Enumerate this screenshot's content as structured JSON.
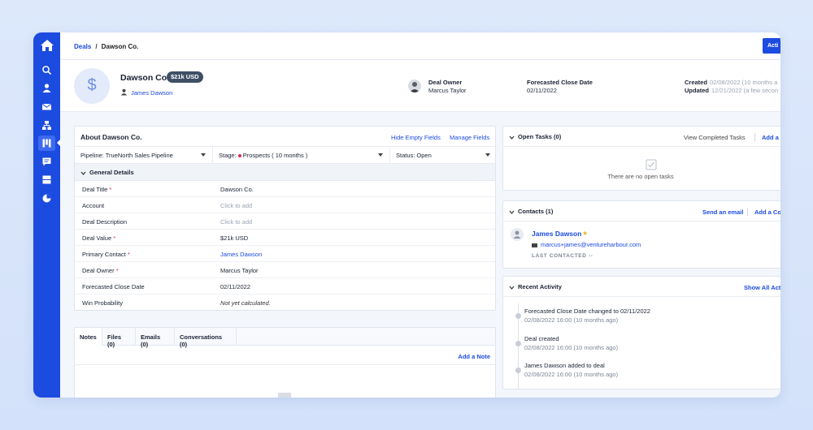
{
  "breadcrumb": {
    "parent": "Deals",
    "separator": "/",
    "current": "Dawson Co."
  },
  "actions_button": "Acti",
  "deal": {
    "name": "Dawson Co.",
    "value_badge": "$21k USD",
    "icon_symbol": "$",
    "contact": "James Dawson"
  },
  "header_meta": {
    "owner_label": "Deal Owner",
    "owner_value": "Marcus Taylor",
    "close_label": "Forecasted Close Date",
    "close_value": "02/11/2022",
    "created_label": "Created",
    "created_value": "02/08/2022 (10 months a",
    "updated_label": "Updated",
    "updated_value": "12/21/2022 (a few secon"
  },
  "about": {
    "title": "About Dawson Co.",
    "hide_empty": "Hide Empty Fields",
    "manage": "Manage Fields",
    "pipeline": "Pipeline: TrueNorth Sales Pipeline",
    "stage_prefix": "Stage:",
    "stage_value": "Prospects ( 10 months )",
    "status": "Status: Open",
    "section": "General Details",
    "fields": [
      {
        "label": "Deal Title",
        "required": "*",
        "value": "Dawson Co."
      },
      {
        "label": "Account",
        "required": "",
        "value": "Click to add"
      },
      {
        "label": "Deal Description",
        "required": "",
        "value": "Click to add"
      },
      {
        "label": "Deal Value",
        "required": "*",
        "value": "$21k USD"
      },
      {
        "label": "Primary Contact",
        "required": "*",
        "value": "James Dawson"
      },
      {
        "label": "Deal Owner",
        "required": "*",
        "value": "Marcus Taylor"
      },
      {
        "label": "Forecasted Close Date",
        "required": "",
        "value": "02/11/2022"
      },
      {
        "label": "Win Probability",
        "required": "",
        "value": "Not yet calculated."
      }
    ]
  },
  "notes": {
    "tabs": [
      "Notes",
      "Files (0)",
      "Emails (0)",
      "Conversations (0)"
    ],
    "add": "Add a Note"
  },
  "tasks": {
    "title": "Open Tasks (0)",
    "view_completed": "View Completed Tasks",
    "add": "Add a t",
    "empty": "There are no open tasks"
  },
  "contacts": {
    "title": "Contacts (1)",
    "send_email": "Send an email",
    "add": "Add a Co",
    "name": "James Dawson",
    "email": "marcus+james@ventureharbour.com",
    "last_contacted": "LAST CONTACTED --"
  },
  "activity": {
    "title": "Recent Activity",
    "show_all": "Show All Acti",
    "items": [
      {
        "text": "Forecasted Close Date changed to 02/11/2022",
        "date": "02/08/2022 16:00 (10 months ago)"
      },
      {
        "text": "Deal created",
        "date": "02/08/2022 16:00 (10 months ago)"
      },
      {
        "text": "James Dawson added to deal",
        "date": "02/08/2022 16:00 (10 months ago)"
      }
    ]
  },
  "colors": {
    "accent": "#1c4be0",
    "required": "#e0294f",
    "star": "#f2b71f",
    "badge": "#3f4f66"
  }
}
